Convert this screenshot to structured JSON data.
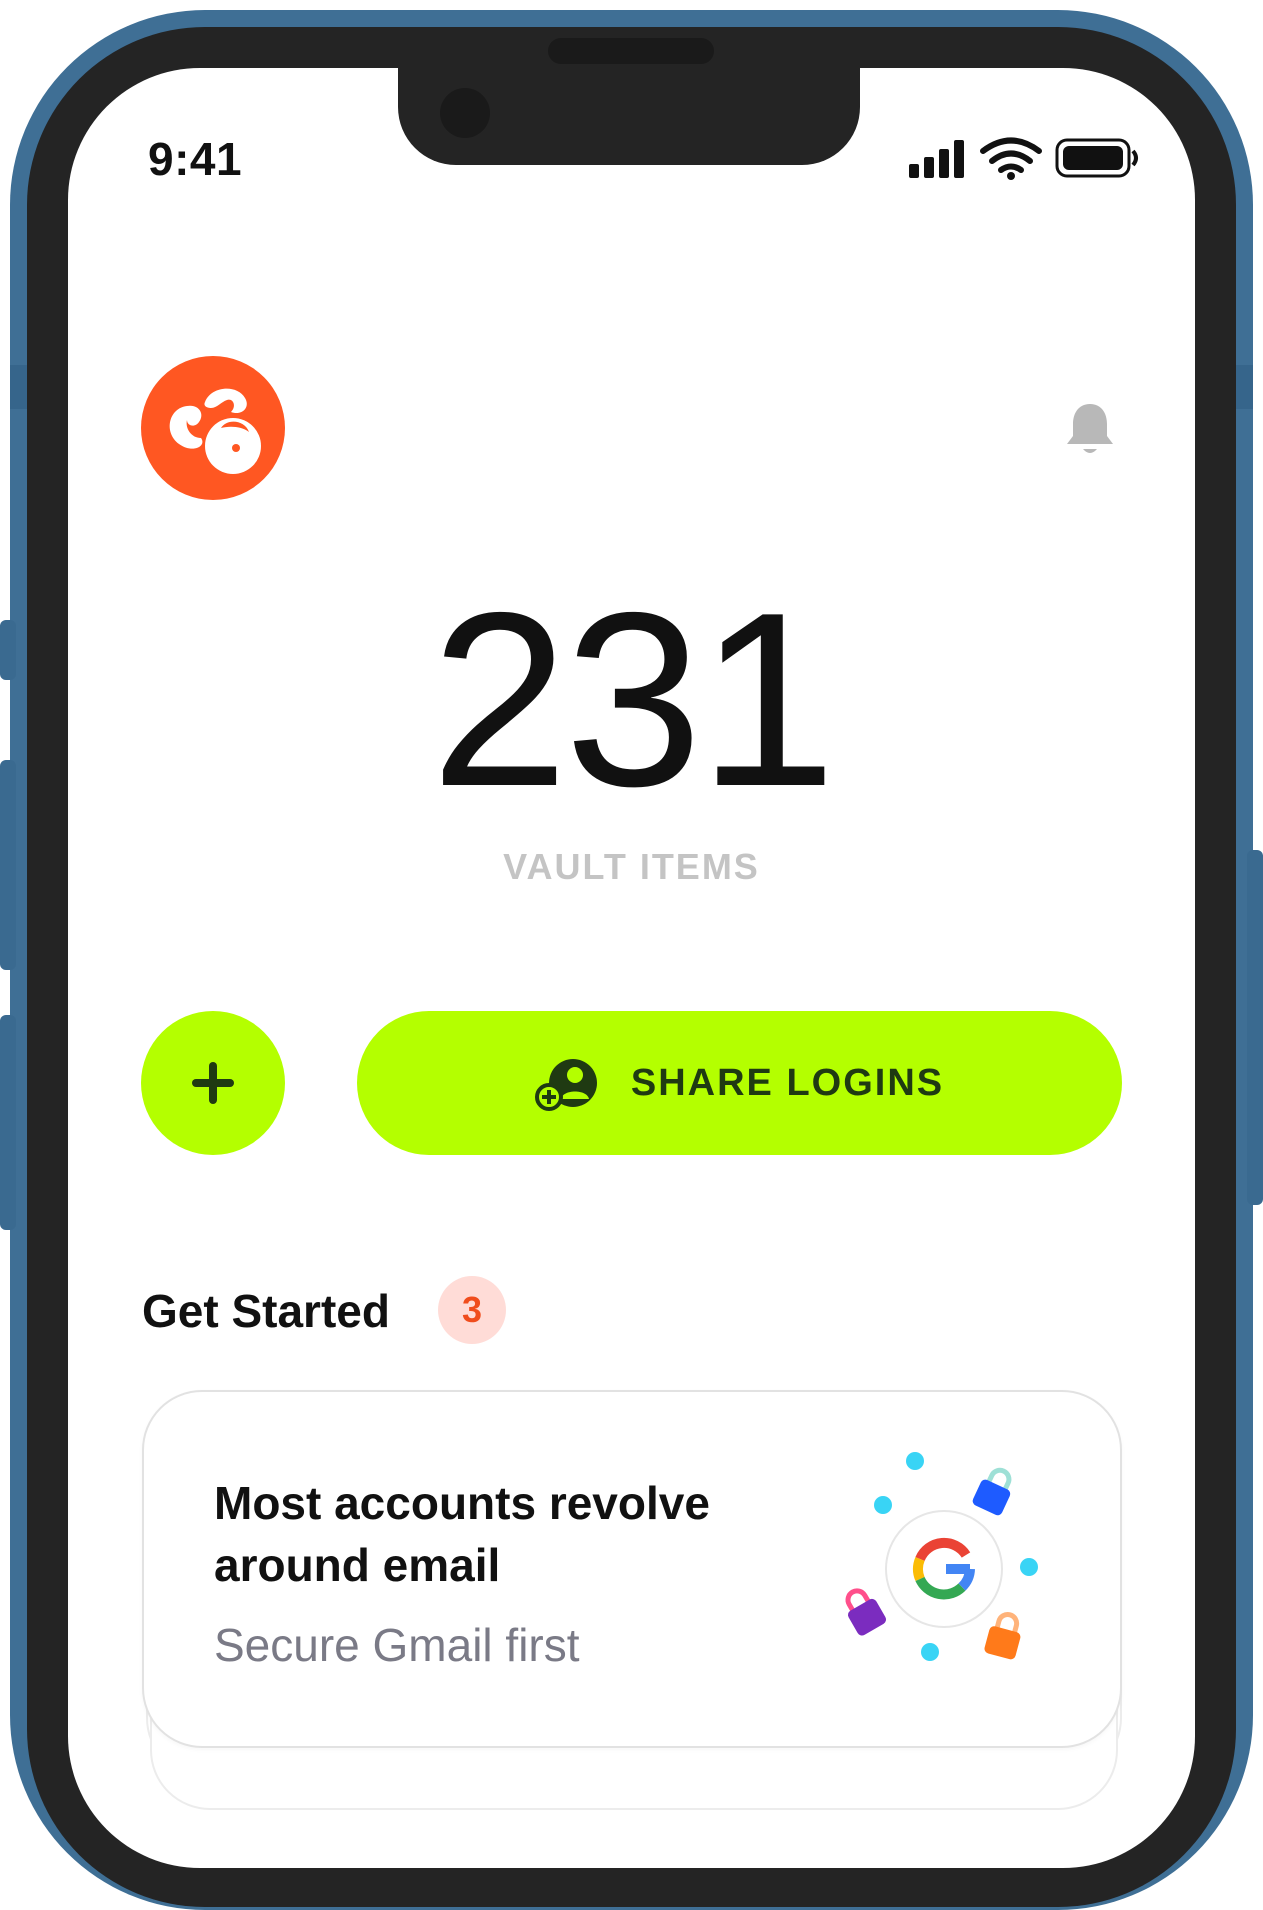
{
  "status_bar": {
    "time": "9:41"
  },
  "header": {
    "logo_icon": "app-logo-icon",
    "notification_icon": "bell-icon"
  },
  "vault": {
    "count": "231",
    "label": "VAULT ITEMS"
  },
  "actions": {
    "add_icon": "plus-icon",
    "share_label": "SHARE LOGINS",
    "share_icon": "add-user-icon"
  },
  "get_started": {
    "title": "Get Started",
    "badge_count": "3"
  },
  "card": {
    "title": "Most accounts revolve around email",
    "subtitle": "Secure Gmail first",
    "illustration_icon": "google-icon"
  },
  "colors": {
    "accent": "#b4ff00",
    "brand": "#ff5722",
    "badge_bg": "#ffdcd7",
    "badge_text": "#f04d1d",
    "frame": "#3f6f95"
  }
}
